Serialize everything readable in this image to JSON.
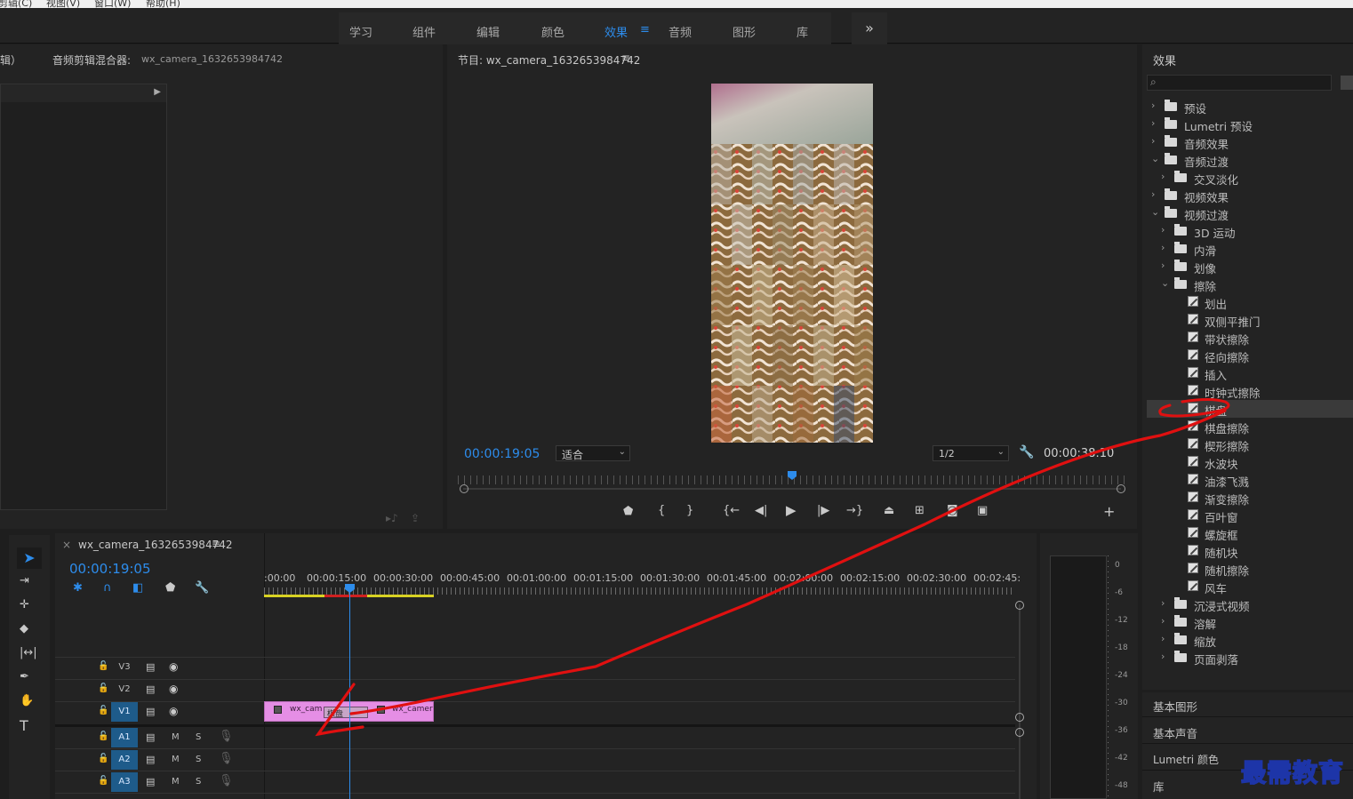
{
  "menubar": [
    "剪辑(C)",
    "视图(V)",
    "窗口(W)",
    "帮助(H)"
  ],
  "workspaces": [
    {
      "label": "学习",
      "active": false
    },
    {
      "label": "组件",
      "active": false
    },
    {
      "label": "编辑",
      "active": false
    },
    {
      "label": "颜色",
      "active": false
    },
    {
      "label": "效果",
      "active": true
    },
    {
      "label": "音频",
      "active": false
    },
    {
      "label": "图形",
      "active": false
    },
    {
      "label": "库",
      "active": false
    }
  ],
  "workspace_menu_icon": "≡",
  "workspace_more": "»",
  "source_panel": {
    "tab_partial": "辑）",
    "mixer_title": "音频剪辑混合器:",
    "mixer_clip": "wx_camera_1632653984742"
  },
  "program_monitor": {
    "title": "节目: wx_camera_1632653984742",
    "menu_icon": "≡",
    "current_time": "00:00:19:05",
    "fit_option": "适合",
    "resolution": "1/2",
    "duration": "00:00:38:10",
    "playhead_fraction": 0.5
  },
  "timeline": {
    "sequence_tab": "wx_camera_1632653984742",
    "close_icon": "×",
    "menu_icon": "≡",
    "current_time": "00:00:19:05",
    "ruler_labels": [
      ":00:00",
      "00:00:15:00",
      "00:00:30:00",
      "00:00:45:00",
      "00:01:00:00",
      "00:01:15:00",
      "00:01:30:00",
      "00:01:45:00",
      "00:02:00:00",
      "00:02:15:00",
      "00:02:30:00",
      "00:02:45:"
    ],
    "video_tracks": [
      "V3",
      "V2",
      "V1"
    ],
    "audio_tracks": [
      "A1",
      "A2",
      "A3"
    ],
    "audio_m": "M",
    "audio_s": "S",
    "clip_a_label": "wx_cam",
    "transition_label": "棋盘",
    "clip_b_label": "wx_camer"
  },
  "meter_labels": [
    "0",
    "-6",
    "-12",
    "-18",
    "-24",
    "-30",
    "-36",
    "-42",
    "-48"
  ],
  "effects_panel": {
    "title": "效果",
    "search_placeholder": "",
    "tree": [
      {
        "label": "预设",
        "depth": 0,
        "kind": "preset",
        "expanded": false
      },
      {
        "label": "Lumetri 预设",
        "depth": 0,
        "kind": "preset",
        "expanded": false
      },
      {
        "label": "音频效果",
        "depth": 0,
        "kind": "folder",
        "expanded": false
      },
      {
        "label": "音频过渡",
        "depth": 0,
        "kind": "folder",
        "expanded": true
      },
      {
        "label": "交叉淡化",
        "depth": 1,
        "kind": "folder",
        "expanded": false
      },
      {
        "label": "视频效果",
        "depth": 0,
        "kind": "folder",
        "expanded": false
      },
      {
        "label": "视频过渡",
        "depth": 0,
        "kind": "folder",
        "expanded": true
      },
      {
        "label": "3D 运动",
        "depth": 1,
        "kind": "folder",
        "expanded": false
      },
      {
        "label": "内滑",
        "depth": 1,
        "kind": "folder",
        "expanded": false
      },
      {
        "label": "划像",
        "depth": 1,
        "kind": "folder",
        "expanded": false
      },
      {
        "label": "擦除",
        "depth": 1,
        "kind": "folder",
        "expanded": true
      },
      {
        "label": "划出",
        "depth": 2,
        "kind": "fx"
      },
      {
        "label": "双侧平推门",
        "depth": 2,
        "kind": "fx"
      },
      {
        "label": "带状擦除",
        "depth": 2,
        "kind": "fx"
      },
      {
        "label": "径向擦除",
        "depth": 2,
        "kind": "fx"
      },
      {
        "label": "插入",
        "depth": 2,
        "kind": "fx"
      },
      {
        "label": "时钟式擦除",
        "depth": 2,
        "kind": "fx"
      },
      {
        "label": "棋盘",
        "depth": 2,
        "kind": "fx",
        "selected": true
      },
      {
        "label": "棋盘擦除",
        "depth": 2,
        "kind": "fx"
      },
      {
        "label": "楔形擦除",
        "depth": 2,
        "kind": "fx"
      },
      {
        "label": "水波块",
        "depth": 2,
        "kind": "fx"
      },
      {
        "label": "油漆飞溅",
        "depth": 2,
        "kind": "fx"
      },
      {
        "label": "渐变擦除",
        "depth": 2,
        "kind": "fx"
      },
      {
        "label": "百叶窗",
        "depth": 2,
        "kind": "fx"
      },
      {
        "label": "螺旋框",
        "depth": 2,
        "kind": "fx"
      },
      {
        "label": "随机块",
        "depth": 2,
        "kind": "fx"
      },
      {
        "label": "随机擦除",
        "depth": 2,
        "kind": "fx"
      },
      {
        "label": "风车",
        "depth": 2,
        "kind": "fx"
      },
      {
        "label": "沉浸式视频",
        "depth": 1,
        "kind": "folder",
        "expanded": false
      },
      {
        "label": "溶解",
        "depth": 1,
        "kind": "folder",
        "expanded": false
      },
      {
        "label": "缩放",
        "depth": 1,
        "kind": "folder",
        "expanded": false
      },
      {
        "label": "页面剥落",
        "depth": 1,
        "kind": "folder",
        "expanded": false
      }
    ]
  },
  "bottom_panels": [
    "基本图形",
    "基本声音",
    "Lumetri 颜色",
    "库"
  ],
  "watermark": "最需教育",
  "colors": {
    "accent": "#2d8ceb",
    "clip_pink": "#e58ee5",
    "annotation_red": "#e01010",
    "panel": "#232323"
  }
}
